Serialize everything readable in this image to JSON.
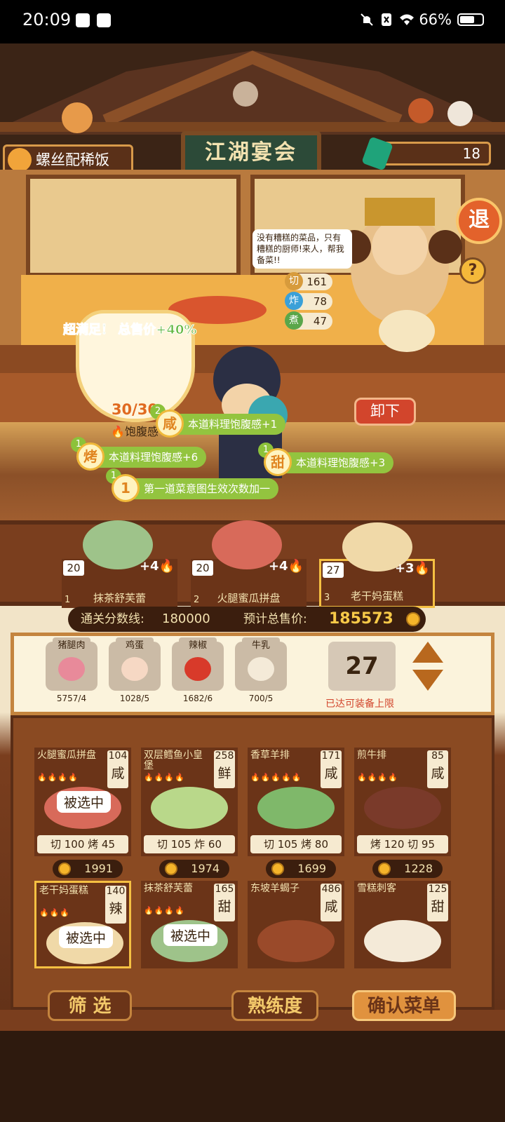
{
  "status": {
    "time": "20:09",
    "battery": "66%"
  },
  "header": {
    "current_dish": "螺丝配稀饭",
    "gem_count": "18",
    "sign": "江湖宴会",
    "exit_label": "退",
    "help_label": "?"
  },
  "customer": {
    "speech": "没有糟糕的菜品，只有糟糕的厨师!来人，帮我备菜!!",
    "stats": [
      {
        "key": "切",
        "value": "161",
        "color": "#d79b3c"
      },
      {
        "key": "炸",
        "value": "78",
        "color": "#3aa0d8"
      },
      {
        "key": "煮",
        "value": "47",
        "color": "#5aa64a"
      }
    ],
    "remove_label": "卸下"
  },
  "bowl": {
    "satisfy_text": "超满足！ 总售价+40%",
    "satiety": "30/30",
    "satiety_label": "饱腹感"
  },
  "effects": [
    {
      "num": "2",
      "tag": "咸",
      "text": "本道料理饱腹感+1"
    },
    {
      "num": "1",
      "tag": "烤",
      "text": "本道料理饱腹感+6"
    },
    {
      "num": "1",
      "tag": "甜",
      "text": "本道料理饱腹感+3"
    },
    {
      "num": "1",
      "tag": "1",
      "text": "第一道菜意图生效次数加一"
    }
  ],
  "selected_dishes": [
    {
      "idx": "1",
      "count": "20",
      "bonus": "+4",
      "name": "抹茶舒芙蕾"
    },
    {
      "idx": "2",
      "count": "20",
      "bonus": "+4",
      "name": "火腿蜜瓜拼盘"
    },
    {
      "idx": "3",
      "count": "27",
      "bonus": "+3",
      "name": "老干妈蛋糕"
    }
  ],
  "score": {
    "threshold_label": "通关分数线:",
    "threshold": "180000",
    "total_label": "预计总售价:",
    "total": "185573"
  },
  "ingredients": [
    {
      "name": "猪腿肉",
      "count": "5757/4"
    },
    {
      "name": "鸡蛋",
      "count": "1028/5"
    },
    {
      "name": "辣椒",
      "count": "1682/6"
    },
    {
      "name": "牛乳",
      "count": "700/5"
    }
  ],
  "capacity": {
    "value": "27",
    "note": "已达可装备上限"
  },
  "recipes": [
    {
      "name": "火腿蜜瓜拼盘",
      "value": "104",
      "flavor": "咸",
      "flames": "🔥🔥🔥🔥",
      "selected": "被选中",
      "skills": "切 100 烤 45",
      "price": "1991"
    },
    {
      "name": "双层鳕鱼小皇堡",
      "value": "258",
      "flavor": "鲜",
      "flames": "🔥🔥🔥🔥",
      "selected": "",
      "skills": "切 105 炸 60",
      "price": "1974"
    },
    {
      "name": "香草羊排",
      "value": "171",
      "flavor": "咸",
      "flames": "🔥🔥🔥🔥🔥",
      "selected": "",
      "skills": "切 105 烤 80",
      "price": "1699"
    },
    {
      "name": "煎牛排",
      "value": "85",
      "flavor": "咸",
      "flames": "🔥🔥🔥🔥",
      "selected": "",
      "skills": "烤 120 切 95",
      "price": "1228"
    },
    {
      "name": "老干妈蛋糕",
      "value": "140",
      "flavor": "辣",
      "flames": "🔥🔥🔥",
      "selected": "被选中",
      "skills": "",
      "price": ""
    },
    {
      "name": "抹茶舒芙蕾",
      "value": "165",
      "flavor": "甜",
      "flames": "🔥🔥🔥🔥",
      "selected": "被选中",
      "skills": "",
      "price": ""
    },
    {
      "name": "东坡羊蝎子",
      "value": "486",
      "flavor": "咸",
      "flames": "",
      "selected": "",
      "skills": "",
      "price": ""
    },
    {
      "name": "雪糕刺客",
      "value": "125",
      "flavor": "甜",
      "flames": "",
      "selected": "",
      "skills": "",
      "price": ""
    }
  ],
  "buttons": {
    "filter": "筛 选",
    "proficiency": "熟练度",
    "confirm": "确认菜单"
  }
}
